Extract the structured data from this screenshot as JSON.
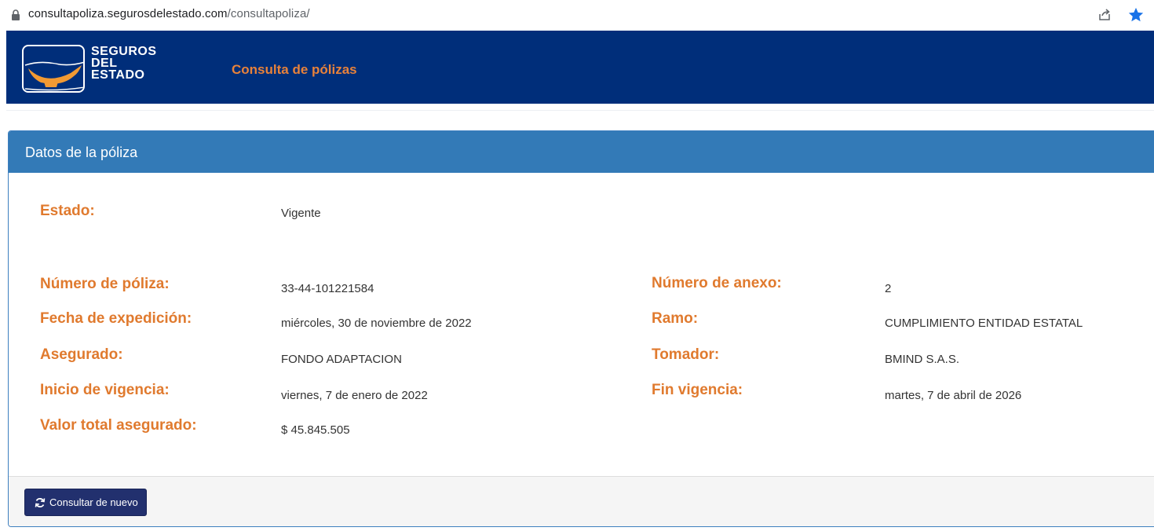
{
  "browser": {
    "url_host": "consultapoliza.segurosdelestado.com",
    "url_path": "/consultapoliza/",
    "icons": [
      "lock-icon",
      "share-icon",
      "star-icon"
    ]
  },
  "header": {
    "logo_lines": [
      "SEGUROS",
      "DEL",
      "ESTADO"
    ],
    "nav_title": "Consulta de pólizas",
    "background": "#002e7a",
    "accent": "#e8823a"
  },
  "panel": {
    "heading": "Datos de la póliza",
    "heading_color": "#337ab7",
    "estado_label": "Estado:",
    "estado_value": "Vigente",
    "left": [
      {
        "label": "Número de póliza:",
        "value": "33-44-101221584"
      },
      {
        "label": "Fecha de expedición:",
        "value": "miércoles, 30 de noviembre de 2022"
      },
      {
        "label": "Asegurado:",
        "value": "FONDO ADAPTACION"
      },
      {
        "label": "Inicio de vigencia:",
        "value": "viernes, 7 de enero de 2022"
      },
      {
        "label": "Valor total asegurado:",
        "value": "$ 45.845.505"
      }
    ],
    "right": [
      {
        "label": "Número de anexo:",
        "value": "2"
      },
      {
        "label": "Ramo:",
        "value": "CUMPLIMIENTO ENTIDAD ESTATAL"
      },
      {
        "label": "Tomador:",
        "value": "BMIND S.A.S."
      },
      {
        "label": "Fin vigencia:",
        "value": "martes, 7 de abril de 2026"
      }
    ],
    "button_label": "Consultar de nuevo",
    "button_icon": "refresh-icon"
  }
}
